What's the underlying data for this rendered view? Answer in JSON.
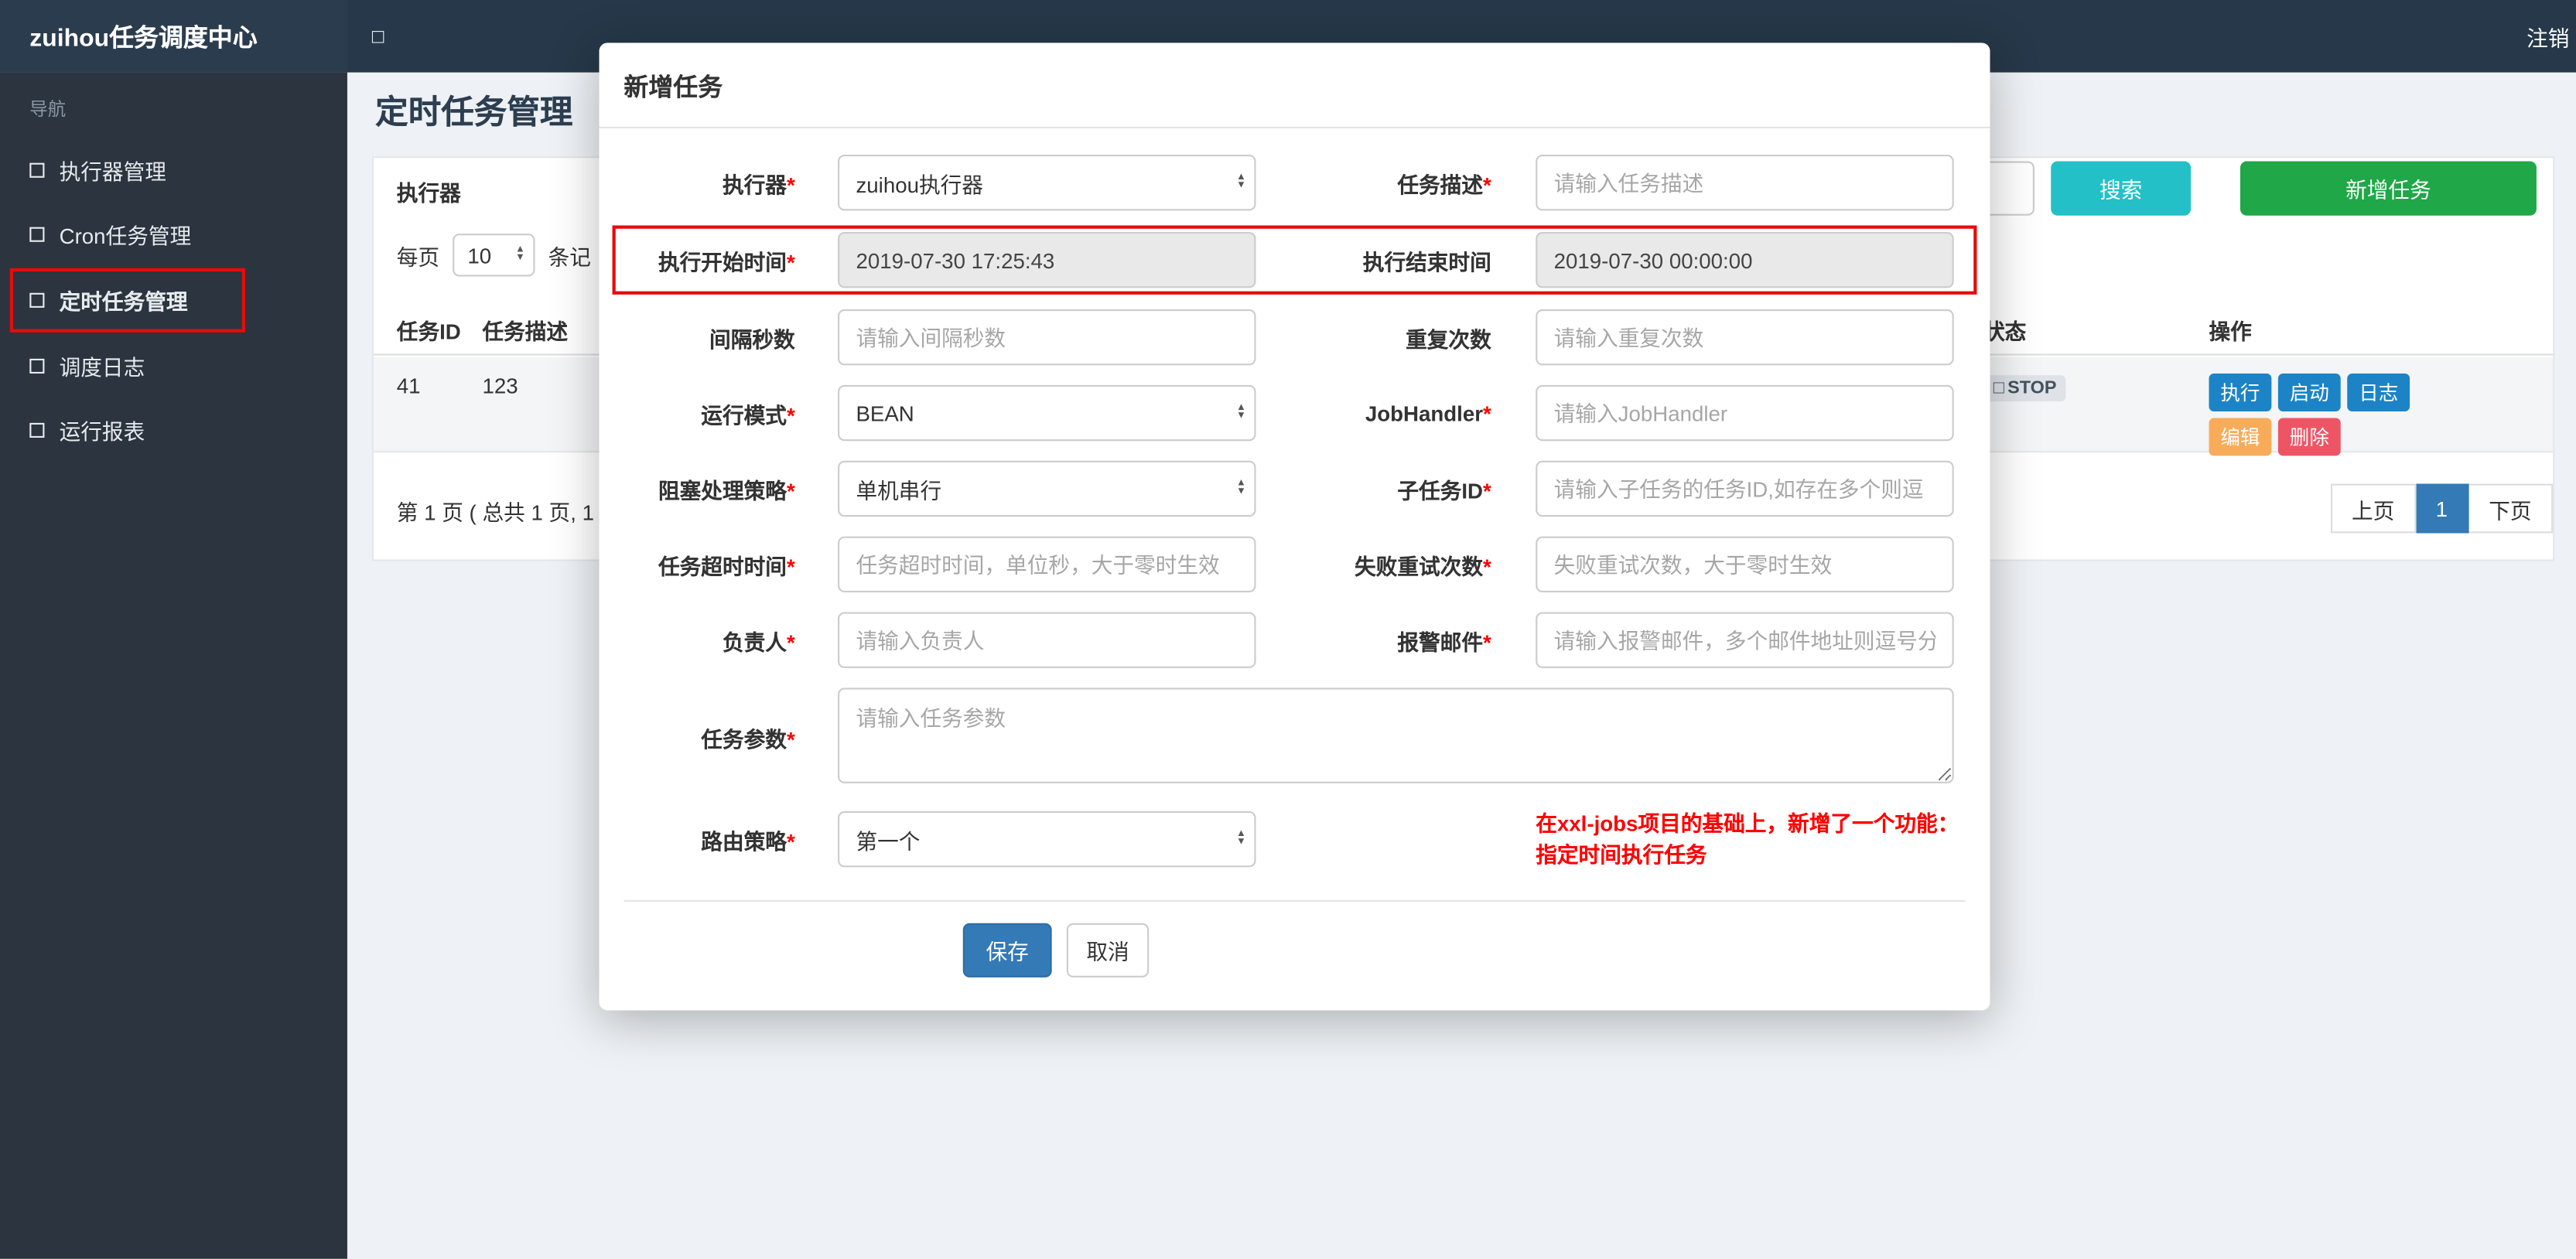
{
  "navbar": {
    "brand": "zuihou任务调度中心",
    "toggle_icon": "□",
    "logout": "注销"
  },
  "sidebar": {
    "section_label": "导航",
    "items": [
      {
        "label": "执行器管理",
        "icon_color": "#e05d52",
        "active": false
      },
      {
        "label": "Cron任务管理",
        "icon_color": "#f0a33f",
        "active": false
      },
      {
        "label": "定时任务管理",
        "icon_color": "#34495e",
        "active": true
      },
      {
        "label": "调度日志",
        "icon_color": "#2ecc71",
        "active": false
      },
      {
        "label": "运行报表",
        "icon_color": "#3bafda",
        "active": false
      }
    ]
  },
  "page": {
    "title": "定时任务管理",
    "filter": {
      "executor_label": "执行器",
      "search_button": "搜索",
      "add_button": "新增任务"
    },
    "per_page": {
      "prefix": "每页",
      "value": "10",
      "suffix": "条记"
    },
    "table": {
      "headers": [
        "任务ID",
        "任务描述",
        "状态",
        "操作"
      ],
      "row": {
        "id": "41",
        "desc": "123",
        "status_icon": "□",
        "status": "STOP",
        "op_execute": "执行",
        "op_start": "启动",
        "op_log": "日志",
        "op_edit": "编辑",
        "op_delete": "删除"
      }
    },
    "pagination": {
      "summary": "第 1 页 ( 总共 1 页, 1",
      "prev": "上页",
      "current": "1",
      "next": "下页"
    }
  },
  "modal": {
    "title": "新增任务",
    "required_mark": "*",
    "f_executor": {
      "label": "执行器",
      "value": "zuihou执行器"
    },
    "f_desc": {
      "label": "任务描述",
      "placeholder": "请输入任务描述"
    },
    "f_start": {
      "label": "执行开始时间",
      "value": "2019-07-30 17:25:43"
    },
    "f_end": {
      "label": "执行结束时间",
      "value": "2019-07-30 00:00:00"
    },
    "f_interval": {
      "label": "间隔秒数",
      "placeholder": "请输入间隔秒数"
    },
    "f_repeat": {
      "label": "重复次数",
      "placeholder": "请输入重复次数"
    },
    "f_mode": {
      "label": "运行模式",
      "value": "BEAN"
    },
    "f_handler": {
      "label": "JobHandler",
      "placeholder": "请输入JobHandler"
    },
    "f_block": {
      "label": "阻塞处理策略",
      "value": "单机串行"
    },
    "f_child": {
      "label": "子任务ID",
      "placeholder": "请输入子任务的任务ID,如存在多个则逗"
    },
    "f_timeout": {
      "label": "任务超时时间",
      "placeholder": "任务超时时间，单位秒，大于零时生效"
    },
    "f_retry": {
      "label": "失败重试次数",
      "placeholder": "失败重试次数，大于零时生效"
    },
    "f_owner": {
      "label": "负责人",
      "placeholder": "请输入负责人"
    },
    "f_email": {
      "label": "报警邮件",
      "placeholder": "请输入报警邮件，多个邮件地址则逗号分"
    },
    "f_params": {
      "label": "任务参数",
      "placeholder": "请输入任务参数"
    },
    "f_route": {
      "label": "路由策略",
      "value": "第一个"
    },
    "note_line1": "在xxl-jobs项目的基础上，新增了一个功能：",
    "note_line2": "指定时间执行任务",
    "save_button": "保存",
    "cancel_button": "取消"
  },
  "colors": {
    "navbar_bg": "#263849",
    "sidebar_bg": "#2b343f",
    "search_teal": "#23c0c8",
    "add_green": "#20a747",
    "save_blue": "#337ab7",
    "op_blue": "#1c84c6",
    "op_orange": "#f8ac59",
    "op_red": "#ed5565",
    "annotation_red": "#e60c0c",
    "note_red": "#ff0000",
    "pagination_active_blue": "#337ab7"
  }
}
